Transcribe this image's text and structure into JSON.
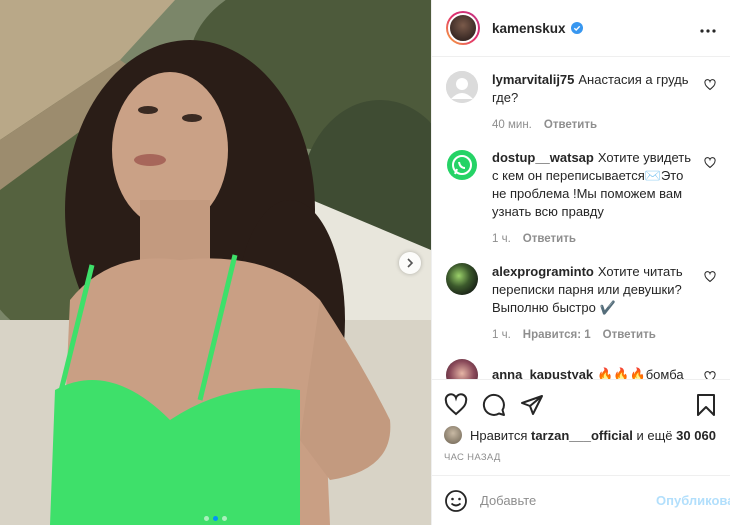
{
  "post": {
    "author": "kamenskux",
    "verified": true,
    "photo_index": 1,
    "photo_count": 3
  },
  "comments": [
    {
      "user": "lymarvitalij75",
      "text": "Анастасия а грудь где?",
      "time": "40 мин.",
      "likes_label": "",
      "reply_label": "Ответить",
      "avatar_color": "#dbdbdb"
    },
    {
      "user": "dostup__watsap",
      "text": "Хотите увидеть с кем он переписывается✉️Это не проблема !Мы поможем вам узнать всю правду",
      "time": "1 ч.",
      "likes_label": "",
      "reply_label": "Ответить",
      "avatar_color": "#25d366"
    },
    {
      "user": "alexprograminto",
      "text": "Хотите читать переписки парня или девушки? Выполню быстро ✔️",
      "time": "1 ч.",
      "likes_label": "Нравится: 1",
      "reply_label": "Ответить",
      "avatar_color": "#2d3a2a"
    },
    {
      "user": "anna_kapustyak",
      "text": "🔥🔥🔥бомба",
      "time": "",
      "likes_label": "",
      "reply_label": "",
      "avatar_color": "#7a3a4a"
    }
  ],
  "likes": {
    "prefix": "Нравится",
    "user": "tarzan___official",
    "middle": "и ещё",
    "count": "30 060"
  },
  "posted_ago": "ЧАС НАЗАД",
  "composer": {
    "placeholder": "Добавьте",
    "publish_label": "Опубликовать"
  },
  "colors": {
    "accent": "#0095f6",
    "publish_disabled": "#b2dffc",
    "verified": "#3897f0"
  },
  "icons": [
    "more-icon",
    "heart-icon",
    "comment-icon",
    "share-icon",
    "bookmark-icon",
    "emoji-icon",
    "chevron-right-icon",
    "verified-icon"
  ]
}
